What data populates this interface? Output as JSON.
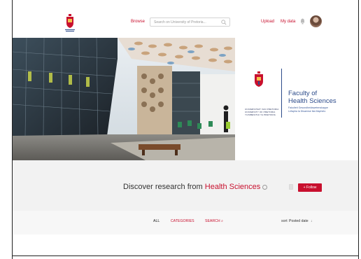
{
  "header": {
    "browse_label": "Browse",
    "search_placeholder": "Search on University of Pretoria...",
    "upload_label": "Upload",
    "mydata_label": "My data",
    "icons": [
      "up-crest-icon",
      "search-icon",
      "bell-icon",
      "avatar"
    ]
  },
  "brand": {
    "univ_lines": [
      "UNIVERSITEIT VAN PRETORIA",
      "UNIVERSITY OF PRETORIA",
      "YUNIBESITHI YA PRETORIA"
    ],
    "faculty_title_1": "Faculty of",
    "faculty_title_2": "Health Sciences",
    "faculty_sub_1": "Fakulteit Gesondheidswetenskappe",
    "faculty_sub_2": "Lefapha la Disaense tša Maphelo",
    "accent": "#2c4b8a"
  },
  "discover": {
    "prefix": "Discover research from ",
    "highlight": "Health Sciences",
    "follow_label": "+ Follow"
  },
  "tabs": {
    "all": "ALL",
    "categories": "CATEGORIES",
    "search": "SEARCH",
    "sort_label": "sort",
    "sort_value": "Posted date",
    "sort_caret": "↓"
  },
  "colors": {
    "brand_red": "#c8102e",
    "band_gray": "#f2f2f2"
  }
}
